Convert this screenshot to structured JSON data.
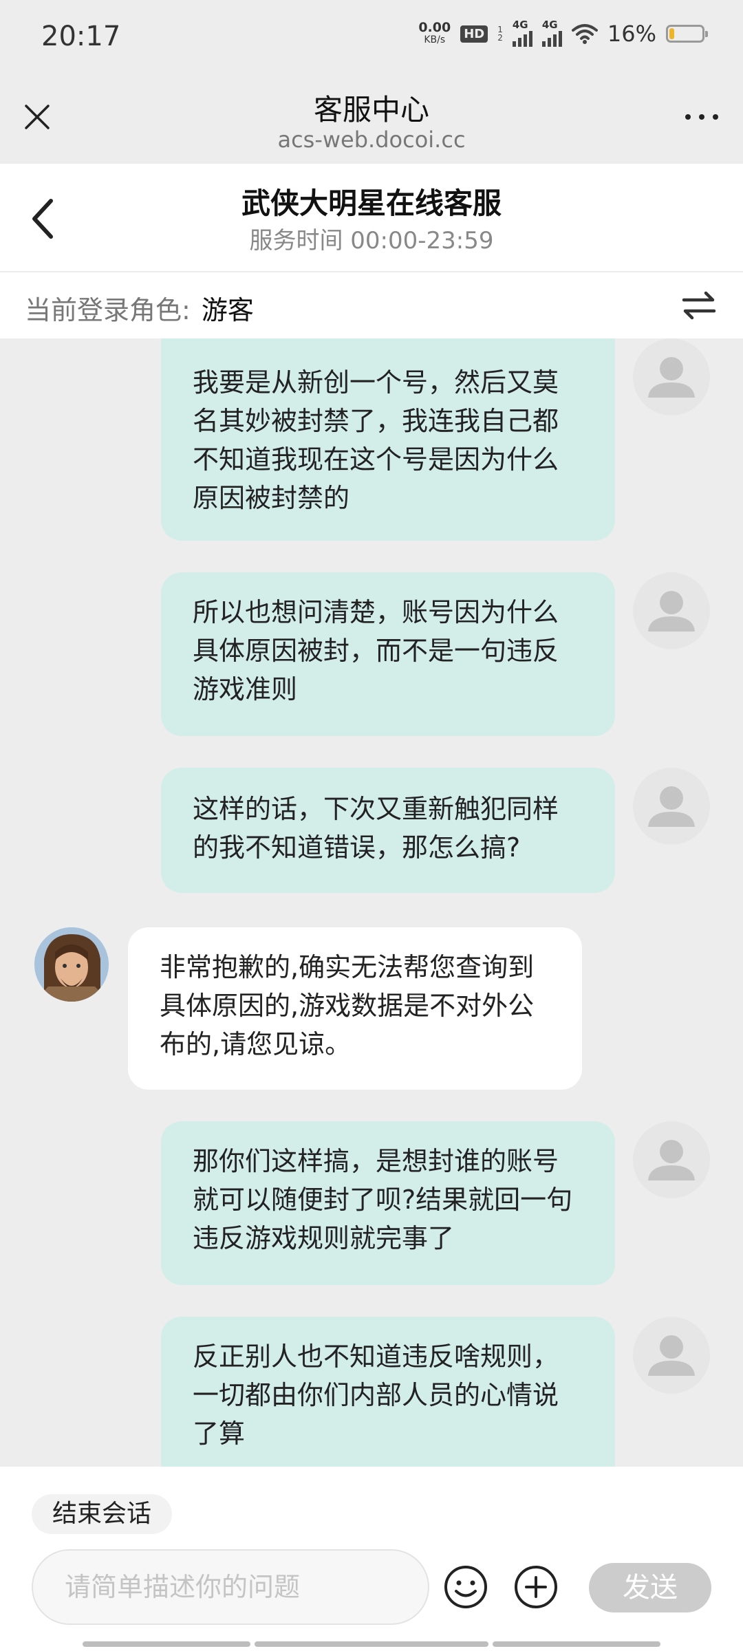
{
  "status_bar": {
    "time": "20:17",
    "net_speed_value": "0.00",
    "net_speed_unit": "KB/s",
    "hd_label": "HD",
    "hd_sub_top": "1",
    "hd_sub_bottom": "2",
    "signal1_label": "4G",
    "signal2_label": "4G",
    "battery_percent": "16%",
    "battery_level": 0.16,
    "battery_color": "#f0b429"
  },
  "web_header": {
    "title": "客服中心",
    "url": "acs-web.docoi.cc",
    "close_icon": "close-icon",
    "more_icon": "more-icon"
  },
  "chat_header": {
    "title": "武侠大明星在线客服",
    "subtitle": "服务时间 00:00-23:59",
    "back_icon": "chevron-left-icon"
  },
  "role_bar": {
    "label": "当前登录角色:",
    "value": "游客",
    "switch_icon": "swap-icon"
  },
  "messages": [
    {
      "sender": "user",
      "text": "我要是从新创一个号，然后又莫名其妙被封禁了，我连我自己都不知道我现在这个号是因为什么原因被封禁的"
    },
    {
      "sender": "user",
      "text": "所以也想问清楚，账号因为什么具体原因被封，而不是一句违反游戏准则"
    },
    {
      "sender": "user",
      "text": "这样的话，下次又重新触犯同样的我不知道错误，那怎么搞?"
    },
    {
      "sender": "agent",
      "text": "非常抱歉的,确实无法帮您查询到具体原因的,游戏数据是不对外公布的,请您见谅。"
    },
    {
      "sender": "user",
      "text": "那你们这样搞，是想封谁的账号就可以随便封了呗?结果就回一句违反游戏规则就完事了"
    },
    {
      "sender": "user",
      "text": "反正别人也不知道违反啥规则，一切都由你们内部人员的心情说了算"
    }
  ],
  "bottom": {
    "end_session_label": "结束会话",
    "input_placeholder": "请简单描述你的问题",
    "input_value": "",
    "send_label": "发送",
    "emoji_icon": "emoji-icon",
    "plus_icon": "plus-circle-icon"
  },
  "colors": {
    "user_bubble": "#d3ede9",
    "agent_bubble": "#ffffff",
    "send_disabled": "#cccccc",
    "background": "#ededed"
  }
}
